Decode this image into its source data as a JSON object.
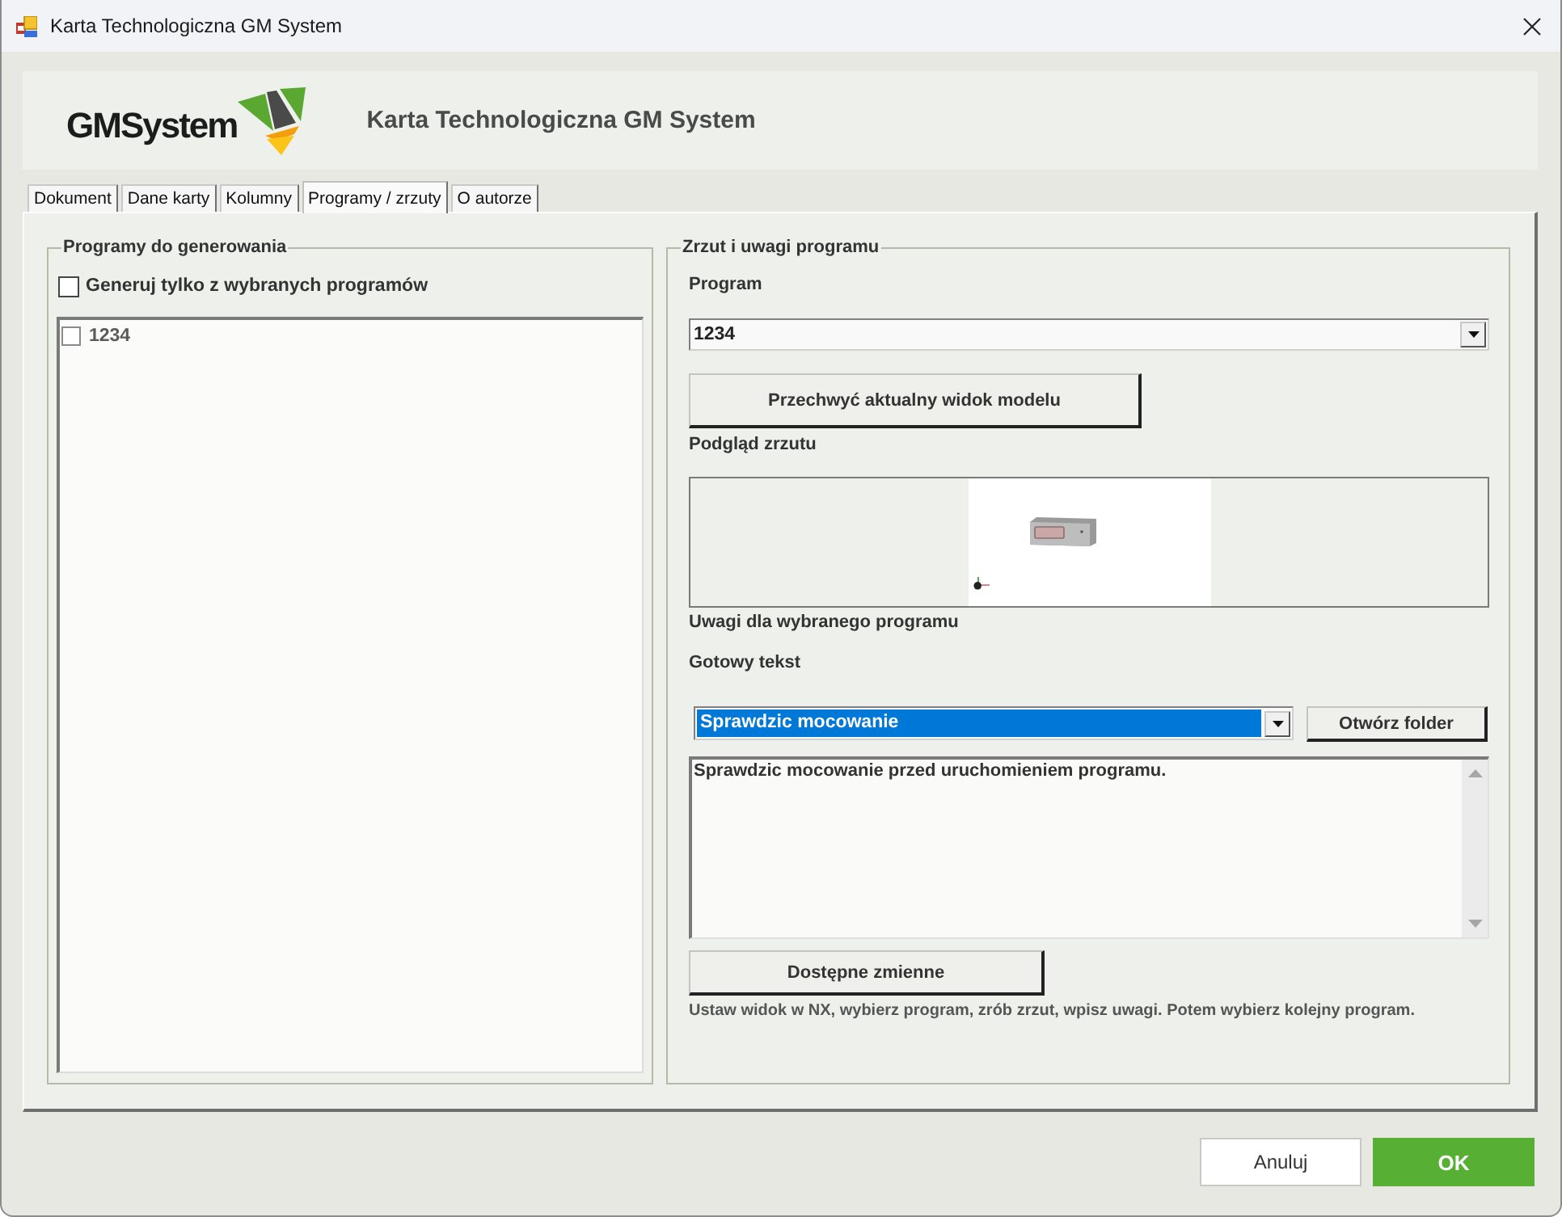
{
  "window": {
    "title": "Karta Technologiczna GM System"
  },
  "header": {
    "logo_text": "GMSystem",
    "title": "Karta Technologiczna GM System"
  },
  "tabs": [
    {
      "label": "Dokument",
      "selected": false
    },
    {
      "label": "Dane karty",
      "selected": false
    },
    {
      "label": "Kolumny",
      "selected": false
    },
    {
      "label": "Programy / zrzuty",
      "selected": true
    },
    {
      "label": "O autorze",
      "selected": false
    }
  ],
  "programs_group": {
    "title": "Programy do generowania",
    "filter": {
      "label": "Generuj tylko z wybranych programów",
      "checked": false
    },
    "items": [
      {
        "label": "1234",
        "checked": false
      }
    ]
  },
  "screenshot_group": {
    "title": "Zrzut i uwagi programu",
    "program": {
      "label": "Program",
      "value": "1234"
    },
    "capture_button": "Przechwyć aktualny widok modelu",
    "preview_label": "Podgląd zrzutu",
    "notes_label": "Uwagi dla wybranego programu",
    "preset": {
      "label": "Gotowy tekst",
      "value": "Sprawdzic mocowanie",
      "focused": true
    },
    "open_folder_button": "Otwórz folder",
    "notes_text": "Sprawdzic mocowanie przed uruchomieniem programu.",
    "variables_button": "Dostępne zmienne",
    "hint": "Ustaw widok w NX, wybierz program, zrób zrzut, wpisz uwagi. Potem wybierz kolejny program."
  },
  "buttons": [
    {
      "label": "Anuluj",
      "kind": "secondary"
    },
    {
      "label": "OK",
      "kind": "primary"
    }
  ]
}
